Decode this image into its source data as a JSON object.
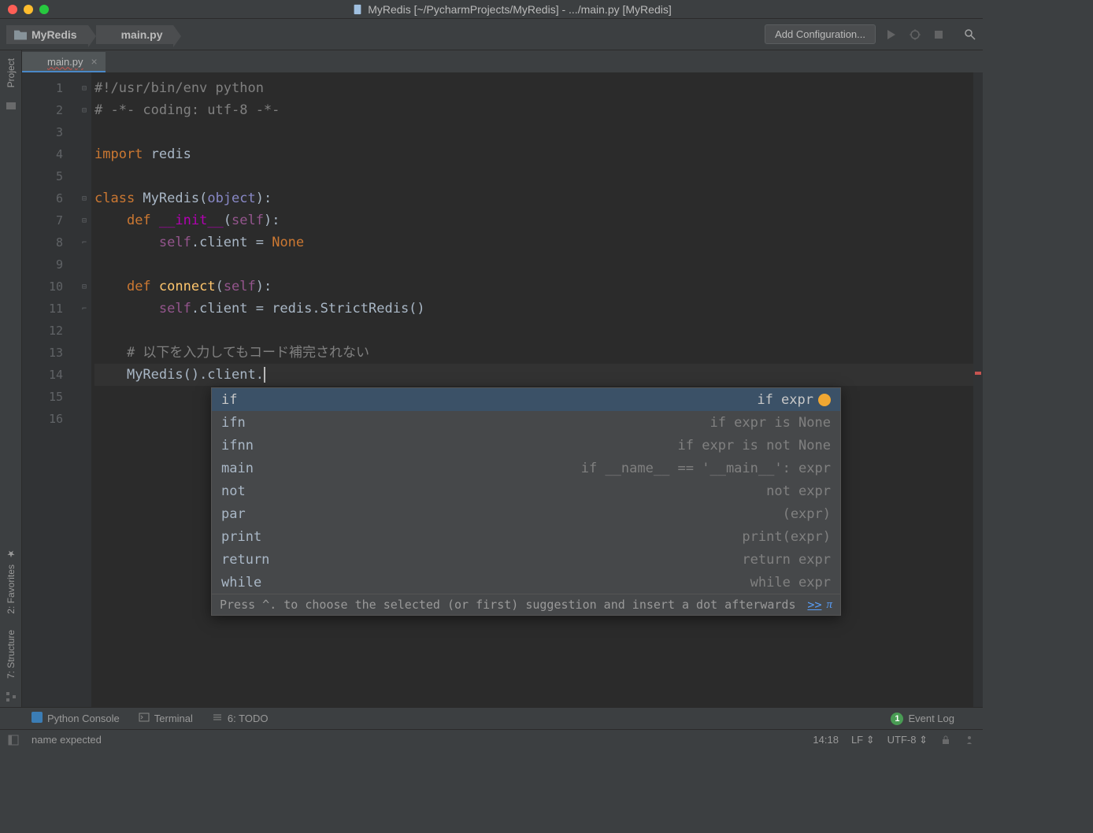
{
  "window": {
    "title": "MyRedis [~/PycharmProjects/MyRedis] - .../main.py [MyRedis]"
  },
  "breadcrumb": {
    "project": "MyRedis",
    "file": "main.py"
  },
  "toolbar": {
    "add_config": "Add Configuration..."
  },
  "left_rail": {
    "project": "Project",
    "favorites": "2: Favorites",
    "structure": "7: Structure"
  },
  "editor_tab": {
    "label": "main.py"
  },
  "line_numbers": [
    "1",
    "2",
    "3",
    "4",
    "5",
    "6",
    "7",
    "8",
    "9",
    "10",
    "11",
    "12",
    "13",
    "14",
    "15",
    "16"
  ],
  "code": {
    "l1_comment": "#!/usr/bin/env python",
    "l2_comment": "# -*- coding: utf-8 -*-",
    "l4_import": "import",
    "l4_redis": " redis",
    "l6_class": "class ",
    "l6_name": "MyRedis",
    "l6_open": "(",
    "l6_obj": "object",
    "l6_close": "):",
    "l7_def": "def ",
    "l7_init": "__init__",
    "l7_open": "(",
    "l7_self": "self",
    "l7_close": "):",
    "l8_self": "self",
    "l8_dot": ".client = ",
    "l8_none": "None",
    "l10_def": "def ",
    "l10_name": "connect",
    "l10_open": "(",
    "l10_self": "self",
    "l10_close": "):",
    "l11_self": "self",
    "l11_rest": ".client = redis.StrictRedis()",
    "l13_comment": "# 以下を入力してもコード補完されない",
    "l14": "MyRedis().client."
  },
  "completion": {
    "items": [
      {
        "l": "if",
        "r": "if expr"
      },
      {
        "l": "ifn",
        "r": "if expr is None"
      },
      {
        "l": "ifnn",
        "r": "if expr is not None"
      },
      {
        "l": "main",
        "r": "if __name__ == '__main__': expr"
      },
      {
        "l": "not",
        "r": "not expr"
      },
      {
        "l": "par",
        "r": "(expr)"
      },
      {
        "l": "print",
        "r": "print(expr)"
      },
      {
        "l": "return",
        "r": "return expr"
      },
      {
        "l": "while",
        "r": "while expr"
      }
    ],
    "hint": "Press ^. to choose the selected (or first) suggestion and insert a dot afterwards",
    "link": ">>"
  },
  "bottom": {
    "python_console": "Python Console",
    "terminal": "Terminal",
    "todo": "6: TODO",
    "event_log": "Event Log",
    "badge": "1"
  },
  "status": {
    "msg": "name expected",
    "pos": "14:18",
    "sep": "LF",
    "enc": "UTF-8"
  }
}
